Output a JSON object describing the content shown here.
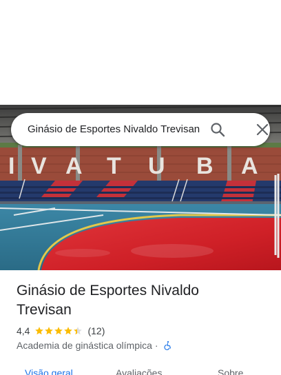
{
  "search": {
    "query": "Ginásio de Esportes Nivaldo Trevisan"
  },
  "photo": {
    "wall_lettering": [
      "I",
      "V",
      "A",
      "T",
      "U",
      "B",
      "A"
    ]
  },
  "place": {
    "title": "Ginásio de Esportes Nivaldo Trevisan",
    "rating": "4,4",
    "stars": 4.4,
    "review_count": "(12)",
    "category": "Academia de ginástica olímpica",
    "separator": "·",
    "accessibility_icon": "wheelchair-icon"
  },
  "tabs": [
    {
      "label": "Visão geral",
      "active": true
    },
    {
      "label": "Avaliações",
      "active": false
    },
    {
      "label": "Sobre",
      "active": false
    }
  ],
  "colors": {
    "accent": "#1a73e8",
    "star": "#fbbc04",
    "court_red": "#d7262c",
    "court_blue": "#2a6f8f"
  }
}
